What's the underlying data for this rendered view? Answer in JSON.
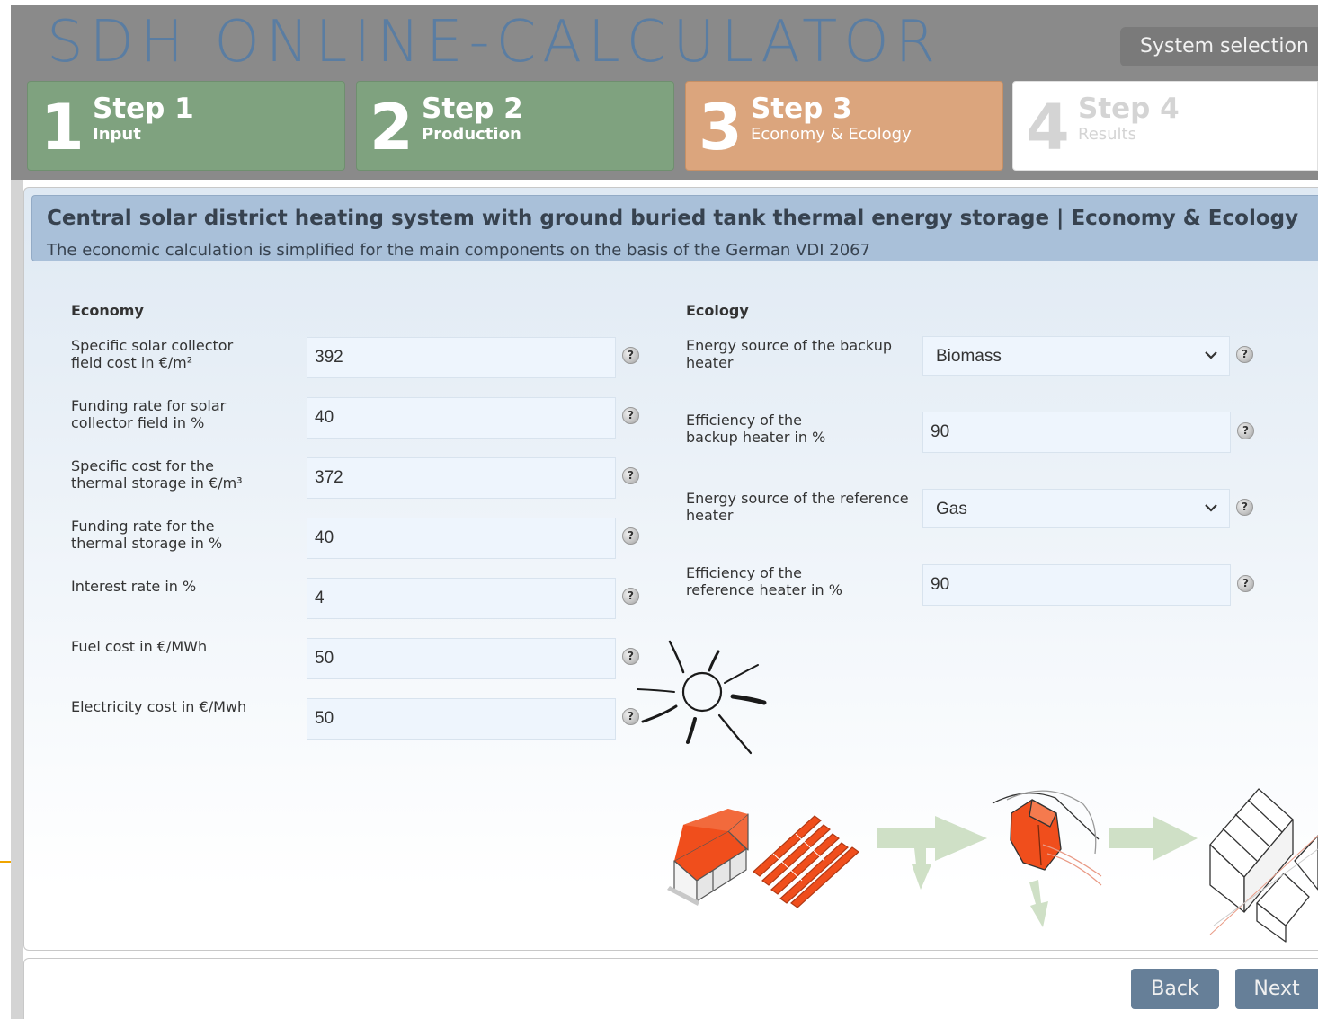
{
  "app": {
    "title": "SDH ONLINE-CALCULATOR",
    "system_selection_label": "System selection"
  },
  "steps": [
    {
      "number": "1",
      "title": "Step 1",
      "subtitle": "Input",
      "state": "completed"
    },
    {
      "number": "2",
      "title": "Step 2",
      "subtitle": "Production",
      "state": "completed"
    },
    {
      "number": "3",
      "title": "Step 3",
      "subtitle": "Economy & Ecology",
      "state": "active"
    },
    {
      "number": "4",
      "title": "Step 4",
      "subtitle": "Results",
      "state": "disabled"
    }
  ],
  "panel": {
    "title": "Central solar district heating system with ground buried tank thermal energy storage | Economy & Ecology",
    "subtitle": "The economic calculation is simplified for the main components on the basis of the German VDI 2067"
  },
  "economy": {
    "heading": "Economy",
    "fields": [
      {
        "label": "Specific solar collector\nfield cost in €/m²",
        "value": "392"
      },
      {
        "label": "Funding rate for solar\ncollector field in %",
        "value": "40"
      },
      {
        "label": "Specific cost for the\nthermal storage in €/m³",
        "value": "372"
      },
      {
        "label": "Funding rate for the\nthermal storage in %",
        "value": "40"
      },
      {
        "label": "Interest rate in %",
        "value": "4"
      },
      {
        "label": "Fuel cost in €/MWh",
        "value": "50"
      },
      {
        "label": "Electricity cost in €/Mwh",
        "value": "50"
      }
    ]
  },
  "ecology": {
    "heading": "Ecology",
    "fields": [
      {
        "label": "Energy source of the backup\nheater",
        "type": "select",
        "value": "Biomass"
      },
      {
        "label": "Efficiency of the\nbackup heater in %",
        "type": "input",
        "value": "90"
      },
      {
        "label": "Energy source of the reference\nheater",
        "type": "select",
        "value": "Gas"
      },
      {
        "label": "Efficiency of the\nreference heater in %",
        "type": "input",
        "value": "90"
      }
    ]
  },
  "help_symbol": "?",
  "footer": {
    "back_label": "Back",
    "next_label": "Next"
  },
  "colors": {
    "header_gray": "#8a8a8a",
    "title_blue": "#5a7da2",
    "step_completed_green": "#7fa27f",
    "step_active_orange": "#dba57d",
    "panel_header_blue": "#a9c0d9",
    "button_blue": "#667f98",
    "illustration_orange": "#f04e1c",
    "arrow_green": "#cfe0c6"
  },
  "icons": [
    "help-icon",
    "chevron-down-icon",
    "sun-illustration",
    "collector-building-illustration",
    "collector-field-illustration",
    "flow-arrow-icon",
    "thermal-storage-illustration",
    "houses-illustration"
  ]
}
